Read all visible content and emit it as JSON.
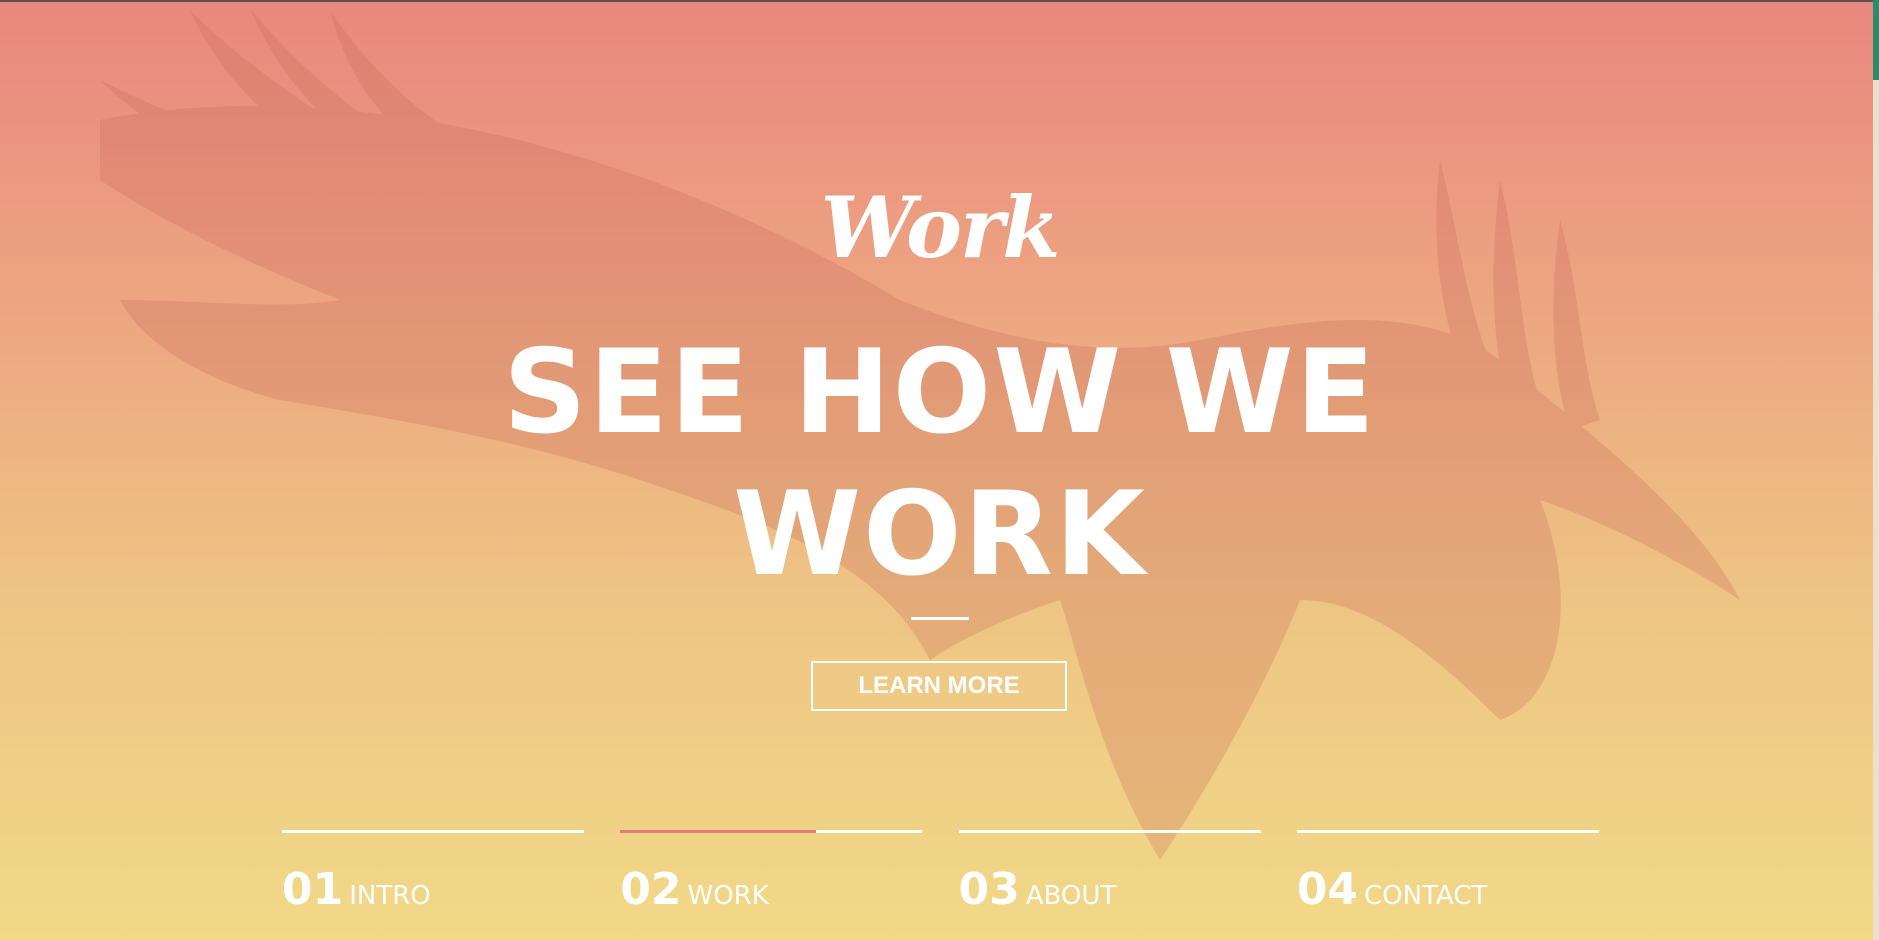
{
  "hero": {
    "script_title": "Work",
    "headline": "SEE HOW WE WORK",
    "cta_label": "LEARN MORE"
  },
  "nav": {
    "items": [
      {
        "number": "01",
        "label": "INTRO",
        "progress": 0
      },
      {
        "number": "02",
        "label": "WORK",
        "progress": 0.65,
        "active": true
      },
      {
        "number": "03",
        "label": "ABOUT",
        "progress": 0
      },
      {
        "number": "04",
        "label": "CONTACT",
        "progress": 0
      }
    ]
  },
  "colors": {
    "gradient_top": "#e9877f",
    "gradient_bottom": "#f1d987",
    "active_accent": "#e8787b",
    "text": "#ffffff"
  }
}
